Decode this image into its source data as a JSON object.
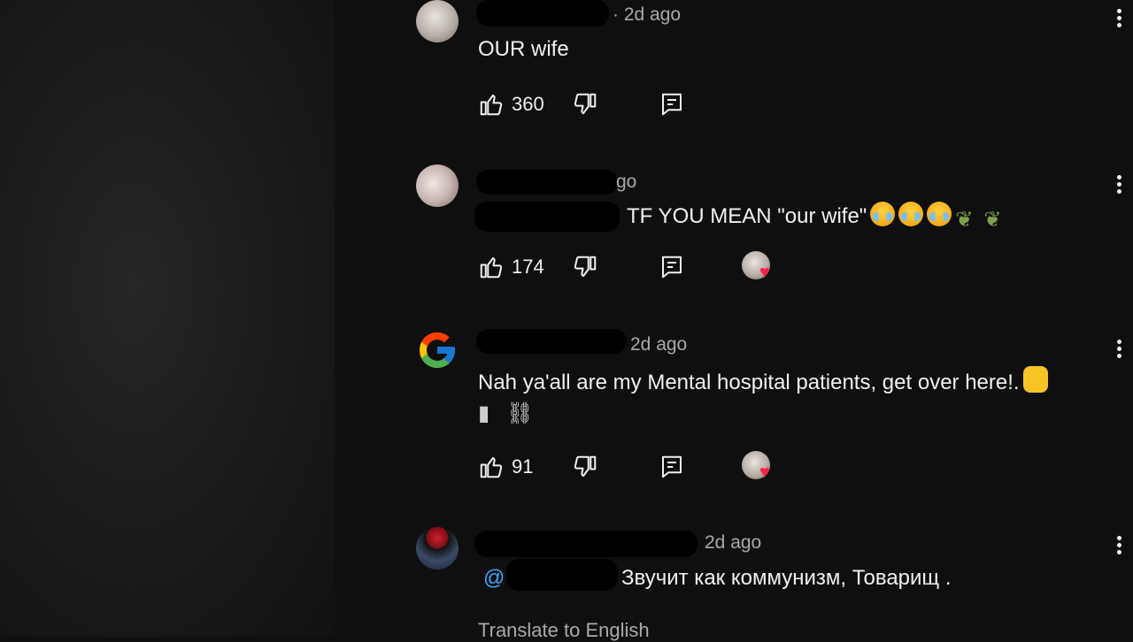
{
  "comments": [
    {
      "time": "· 2d ago",
      "text": "OUR wife",
      "likes": "360",
      "has_heart": false
    },
    {
      "time": "go",
      "mention": "",
      "text": "TF YOU MEAN \"our wife\"",
      "likes": "174",
      "has_heart": true
    },
    {
      "time": "2d ago",
      "text": "Nah ya'all are my Mental hospital patients, get over here!.",
      "likes": "91",
      "has_heart": true
    },
    {
      "time": "2d ago",
      "mention": "@",
      "text": "Звучит как коммунизм, Товарищ ."
    }
  ],
  "translate_link": "Translate to English",
  "icons": {
    "like": "thumbs-up-icon",
    "dislike": "thumbs-down-icon",
    "reply": "reply-icon",
    "more": "more-vert-icon",
    "heart": "heart-icon",
    "avatar_google": "google-logo-icon"
  },
  "colors": {
    "background": "#0f0f0f",
    "text": "#f1f1f1",
    "secondary": "#aaaaaa",
    "mention": "#3ea6ff",
    "heart": "#ff1f44"
  }
}
